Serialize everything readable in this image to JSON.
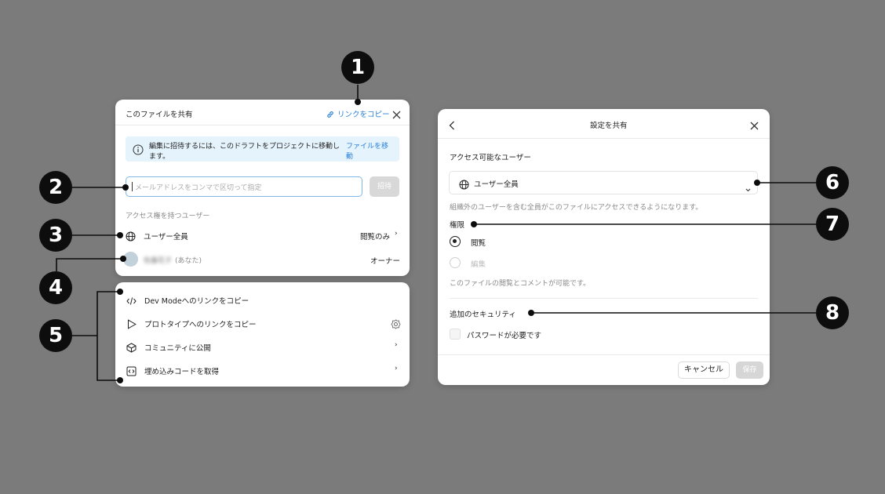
{
  "share_panel": {
    "title": "このファイルを共有",
    "copy_link_label": "リンクをコピー",
    "info_text_line1": "編集に招待するには、このドラフトをプロジェクトに移動し",
    "info_text_line2": "ます。",
    "move_file_line1": "ファイルを移",
    "move_file_line2": "動",
    "email_placeholder": "メールアドレスをコンマで区切って指定",
    "invite_label": "招待",
    "section_label": "アクセス権を持つユーザー",
    "users": [
      {
        "name": "ユーザー全員",
        "role": "閲覧のみ",
        "icon": "globe-icon"
      },
      {
        "name": "佐藤花子",
        "you_suffix": "(あなた)",
        "role": "オーナー",
        "icon": "avatar"
      }
    ]
  },
  "links_panel": {
    "items": [
      {
        "label": "Dev Modeへのリンクをコピー",
        "icon": "code-icon"
      },
      {
        "label": "プロトタイプへのリンクをコピー",
        "icon": "play-icon",
        "trailing": "gear-icon"
      },
      {
        "label": "コミュニティに公開",
        "icon": "community-icon",
        "trailing": "chevron-right-icon"
      },
      {
        "label": "埋め込みコードを取得",
        "icon": "embed-icon",
        "trailing": "chevron-right-icon"
      }
    ]
  },
  "settings_panel": {
    "title": "設定を共有",
    "access_label": "アクセス可能なユーザー",
    "dropdown_value": "ユーザー全員",
    "access_desc": "組織外のユーザーを含む全員がこのファイルにアクセスできるようになります。",
    "permission_label": "権限",
    "options": [
      {
        "label": "閲覧",
        "selected": true
      },
      {
        "label": "編集",
        "selected": false
      }
    ],
    "permission_desc": "このファイルの閲覧とコメントが可能です。",
    "security_label": "追加のセキュリティ",
    "password_label": "パスワードが必要です",
    "cancel_label": "キャンセル",
    "save_label": "保存"
  },
  "callouts": [
    "1",
    "2",
    "3",
    "4",
    "5",
    "6",
    "7",
    "8"
  ],
  "colors": {
    "background": "#7b7b7b",
    "link_blue": "#2a80d6",
    "info_bg": "#e5f3fc",
    "callout": "#0d0d0d"
  }
}
